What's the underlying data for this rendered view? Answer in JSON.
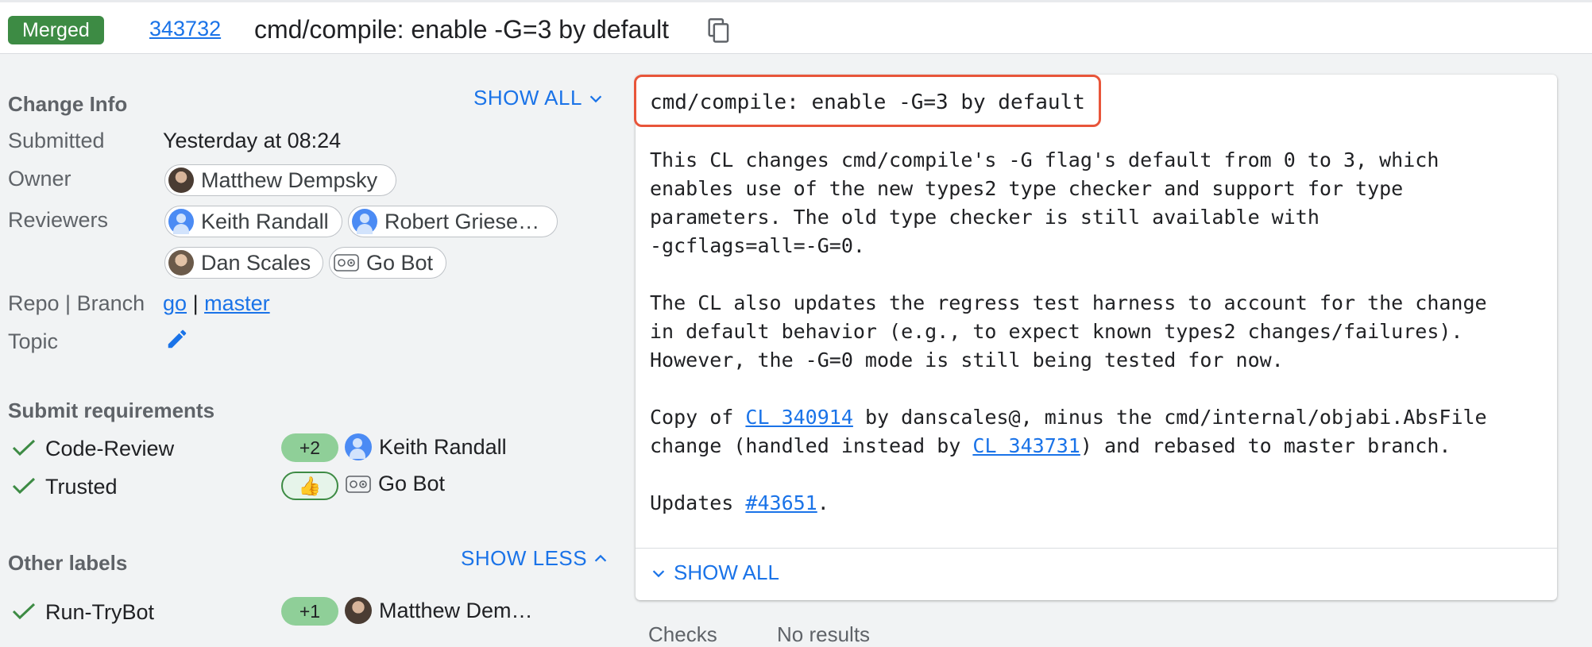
{
  "header": {
    "status_badge": "Merged",
    "cl_number": "343732",
    "title": "cmd/compile: enable -G=3 by default"
  },
  "change_info": {
    "heading": "Change Info",
    "show_all_label": "SHOW ALL",
    "submitted_label": "Submitted",
    "submitted_value": "Yesterday at 08:24",
    "owner_label": "Owner",
    "owner": "Matthew Dempsky",
    "reviewers_label": "Reviewers",
    "reviewers": [
      "Keith Randall",
      "Robert Griese…",
      "Dan Scales",
      "Go Bot"
    ],
    "repo_branch_label": "Repo | Branch",
    "repo": "go",
    "separator": "|",
    "branch": "master",
    "topic_label": "Topic"
  },
  "submit_requirements": {
    "heading": "Submit requirements",
    "items": [
      {
        "name": "Code-Review",
        "vote": "+2",
        "voter": "Keith Randall"
      },
      {
        "name": "Trusted",
        "vote": "👍",
        "voter": "Go Bot"
      }
    ]
  },
  "other_labels": {
    "heading": "Other labels",
    "show_less_label": "SHOW LESS",
    "items": [
      {
        "name": "Run-TryBot",
        "vote": "+1",
        "voter": "Matthew Dem…"
      }
    ]
  },
  "commit_message": {
    "subject": "cmd/compile: enable -G=3 by default",
    "p1": "This CL changes cmd/compile's -G flag's default from 0 to 3, which\nenables use of the new types2 type checker and support for type\nparameters. The old type checker is still available with\n-gcflags=all=-G=0.",
    "p2": "The CL also updates the regress test harness to account for the change\nin default behavior (e.g., to expect known types2 changes/failures).\nHowever, the -G=0 mode is still being tested for now.",
    "p3_a": "Copy of ",
    "p3_link1": "CL 340914",
    "p3_b": " by danscales@, minus the cmd/internal/objabi.AbsFile\nchange (handled instead by ",
    "p3_link2": "CL 343731",
    "p3_c": ") and rebased to master branch.",
    "p4_a": "Updates ",
    "p4_link": "#43651",
    "p4_b": ".",
    "show_all_label": "SHOW ALL"
  },
  "checks": {
    "label": "Checks",
    "value": "No results"
  },
  "colors": {
    "merged_badge": "#3d8b44",
    "link": "#1a73e8",
    "highlight_box": "#e8553a",
    "approved_vote": "#8fcf98"
  }
}
